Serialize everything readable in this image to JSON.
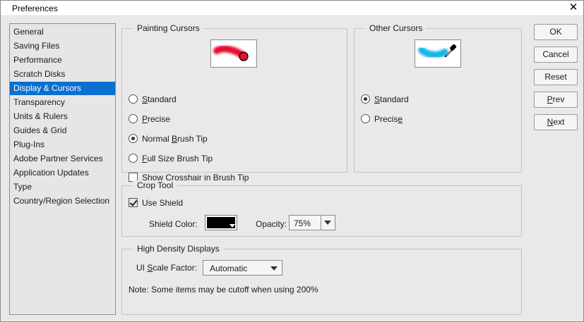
{
  "window": {
    "title": "Preferences"
  },
  "categories": [
    "General",
    "Saving Files",
    "Performance",
    "Scratch Disks",
    "Display & Cursors",
    "Transparency",
    "Units & Rulers",
    "Guides & Grid",
    "Plug-Ins",
    "Adobe Partner Services",
    "Application Updates",
    "Type",
    "Country/Region Selection"
  ],
  "selected_category": "Display & Cursors",
  "painting_cursors": {
    "legend": "Painting Cursors",
    "options": {
      "standard": {
        "pre": "",
        "u": "S",
        "post": "tandard"
      },
      "precise": {
        "pre": "",
        "u": "P",
        "post": "recise"
      },
      "normal_brush_tip": {
        "pre": "Normal ",
        "u": "B",
        "post": "rush Tip"
      },
      "full_size_brush_tip": {
        "pre": "",
        "u": "F",
        "post": "ull Size Brush Tip"
      }
    },
    "selected": "Normal Brush Tip",
    "crosshair": {
      "pre": "Show ",
      "u": "C",
      "post": "rosshair in Brush Tip",
      "checked": false
    },
    "preview_color": "#e8112d"
  },
  "other_cursors": {
    "legend": "Other Cursors",
    "options": {
      "standard": {
        "pre": "",
        "u": "S",
        "post": "tandard"
      },
      "precise": {
        "pre": "Precis",
        "u": "e",
        "post": ""
      }
    },
    "selected": "Standard",
    "preview_color": "#19b6e6"
  },
  "crop_tool": {
    "legend": "Crop Tool",
    "use_shield": {
      "label": "Use Shield",
      "checked": true
    },
    "shield_color_label": "Shield Color:",
    "shield_color": "#000000",
    "opacity_label": "Opacity:",
    "opacity_value": "75%"
  },
  "high_density": {
    "legend": "High Density Displays",
    "scale_label": {
      "pre": "UI ",
      "u": "S",
      "post": "cale Factor:"
    },
    "scale_value": "Automatic",
    "note": "Note: Some items may be cutoff when using 200%"
  },
  "buttons": {
    "ok": "OK",
    "cancel": "Cancel",
    "reset": "Reset",
    "prev": {
      "u": "P",
      "post": "rev"
    },
    "next": {
      "u": "N",
      "post": "ext"
    }
  },
  "colors": {
    "selection": "#0a6fd0"
  }
}
